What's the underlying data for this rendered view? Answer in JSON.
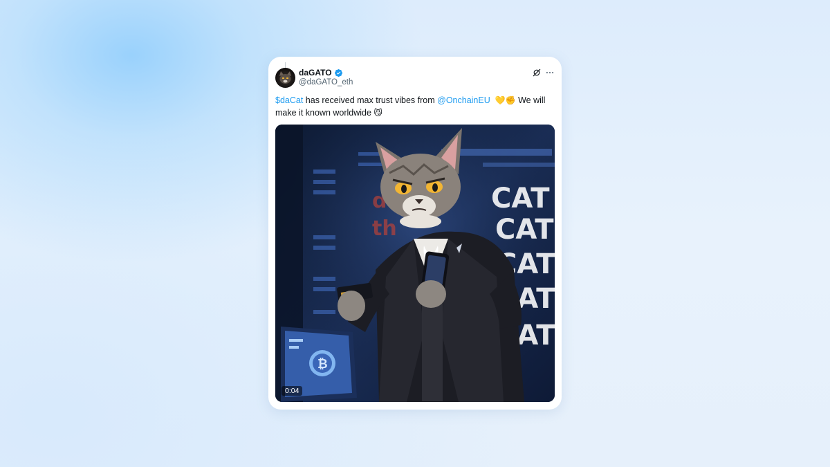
{
  "post": {
    "author": {
      "display_name": "daGATO",
      "handle": "@daGATO_eth",
      "verified": true,
      "avatar_icon": "cat-avatar"
    },
    "actions": {
      "grok_icon": "grok-icon",
      "more_icon": "more-options-icon"
    },
    "text": {
      "cashtag": "$daCat",
      "part1": " has received max trust vibes from ",
      "mention": "@OnchainEU",
      "emoji1": "💛✊",
      "part2": " We will make it known worldwide ",
      "emoji2": "😼"
    },
    "media": {
      "type": "video",
      "duration": "0:04",
      "description_icon": "cat-in-suit-video",
      "screen_text": [
        "CAT",
        "CAT",
        "CAT",
        "CAT",
        "CAT"
      ]
    }
  },
  "colors": {
    "link": "#1d9bf0",
    "text": "#0f1419",
    "secondary_text": "#536471",
    "verified": "#1d9bf0"
  }
}
